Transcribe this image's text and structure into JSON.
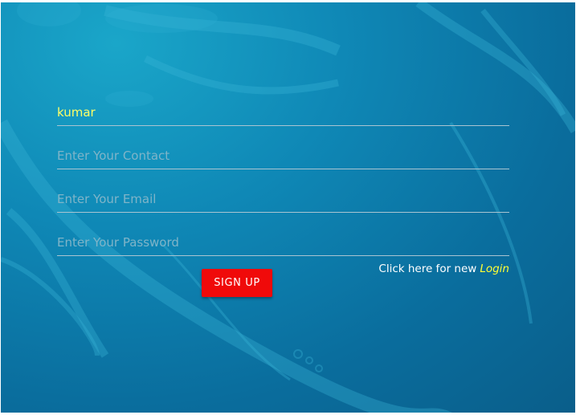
{
  "form": {
    "name_value": "kumar",
    "contact_placeholder": "Enter Your Contact",
    "email_placeholder": "Enter Your Email",
    "password_placeholder": "Enter Your Password",
    "signup_label": "SIGN UP",
    "login_prompt": "Click here for new",
    "login_link": "Login"
  },
  "colors": {
    "background": "#0f88b6",
    "accent_yellow": "#ffff33",
    "button_red": "#f00a0a"
  }
}
